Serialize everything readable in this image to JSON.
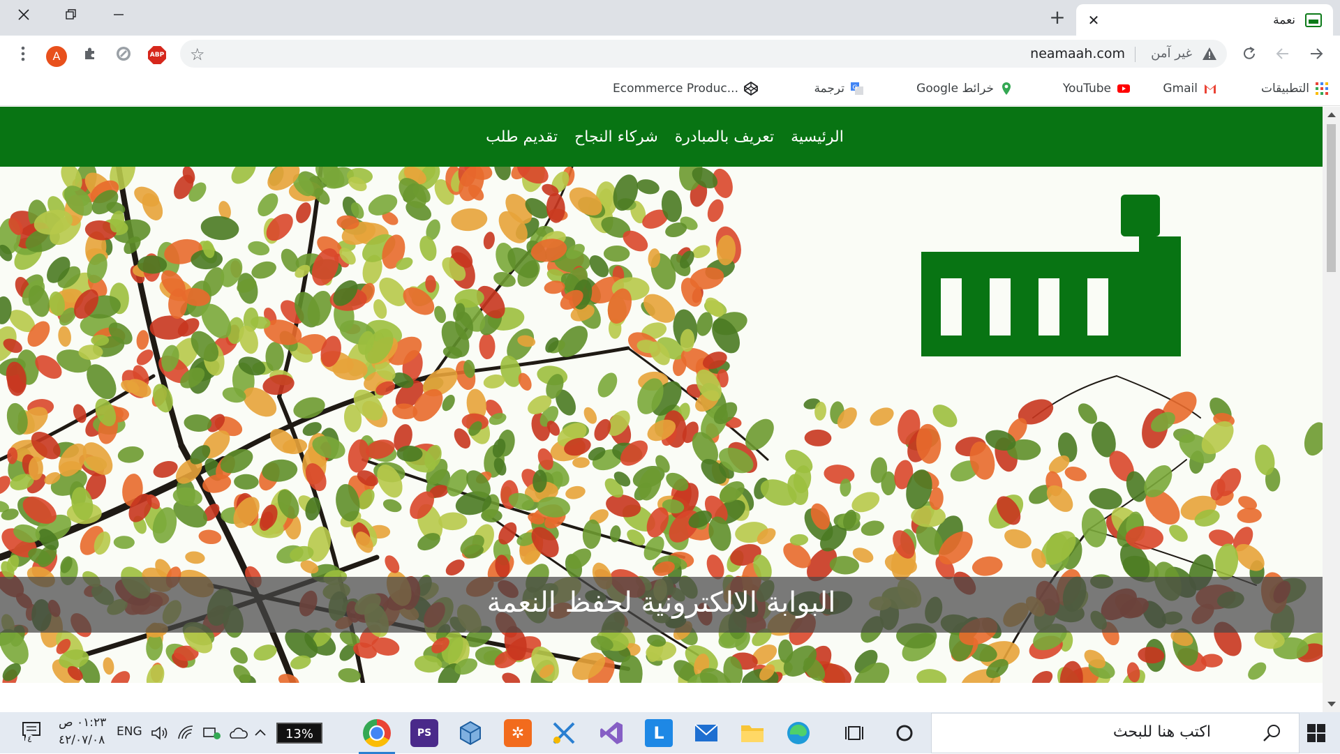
{
  "browser": {
    "tab_title": "نعمة",
    "tab_close": "✕",
    "new_tab": "+",
    "url": "neamaah.com",
    "security_label": "غير آمن",
    "profile_initial": "A",
    "adblock_label": "ABP"
  },
  "bookmarks": [
    {
      "label": "التطبيقات",
      "icon": "apps-grid-icon"
    },
    {
      "label": "Gmail",
      "icon": "gmail-icon"
    },
    {
      "label": "YouTube",
      "icon": "youtube-icon"
    },
    {
      "label": "Google خرائط",
      "icon": "maps-icon"
    },
    {
      "label": "ترجمة",
      "icon": "translate-icon"
    },
    {
      "label": "Ecommerce Produc...",
      "icon": "codepen-icon"
    }
  ],
  "nav": {
    "home": "الرئيسية",
    "about": "تعريف بالمبادرة",
    "partners": "شركاء النجاح",
    "apply": "تقديم طلب"
  },
  "hero": {
    "caption": "البوابة الالكترونية لحفظ النعمة"
  },
  "taskbar": {
    "search_placeholder": "اكتب هنا للبحث",
    "language": "ENG",
    "time": "٠١:٢٣ ص",
    "date": "٤٢/٠٧/٠٨",
    "battery_percent": "13%",
    "notification_count": "٤"
  },
  "colors": {
    "brand_green": "#087413",
    "tab_strip": "#dee1e6",
    "taskbar": "#e4eaf2"
  }
}
